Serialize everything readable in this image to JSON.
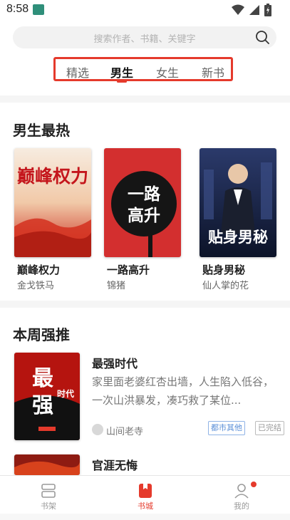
{
  "status_bar": {
    "time": "8:58"
  },
  "search": {
    "placeholder": "搜索作者、书籍、关键字"
  },
  "tabs": [
    {
      "label": "精选"
    },
    {
      "label": "男生"
    },
    {
      "label": "女生"
    },
    {
      "label": "新书"
    }
  ],
  "hot_section": {
    "title": "男生最热",
    "books": [
      {
        "title": "巅峰权力",
        "author": "金戈铁马",
        "cover_text": "巅峰权力"
      },
      {
        "title": "一路高升",
        "author": "锦猪",
        "cover_text": "一路高升"
      },
      {
        "title": "贴身男秘",
        "author": "仙人掌的花",
        "cover_text": "贴身男秘"
      }
    ]
  },
  "weekly_section": {
    "title": "本周强推",
    "items": [
      {
        "title": "最强时代",
        "description": "家里面老婆红杏出墙，人生陷入低谷，一次山洪暴发，凑巧救了某位...",
        "author": "山间老寺",
        "genre_tag": "都市其他",
        "status_tag": "已完结",
        "cover_text": "最强时代"
      },
      {
        "title": "官涯无悔"
      }
    ]
  },
  "bottom_nav": [
    {
      "label": "书架",
      "icon": "bookshelf-icon"
    },
    {
      "label": "书城",
      "icon": "bookstore-icon"
    },
    {
      "label": "我的",
      "icon": "profile-icon"
    }
  ],
  "colors": {
    "accent": "#e53a2c",
    "tag_blue": "#5b8fd8"
  }
}
